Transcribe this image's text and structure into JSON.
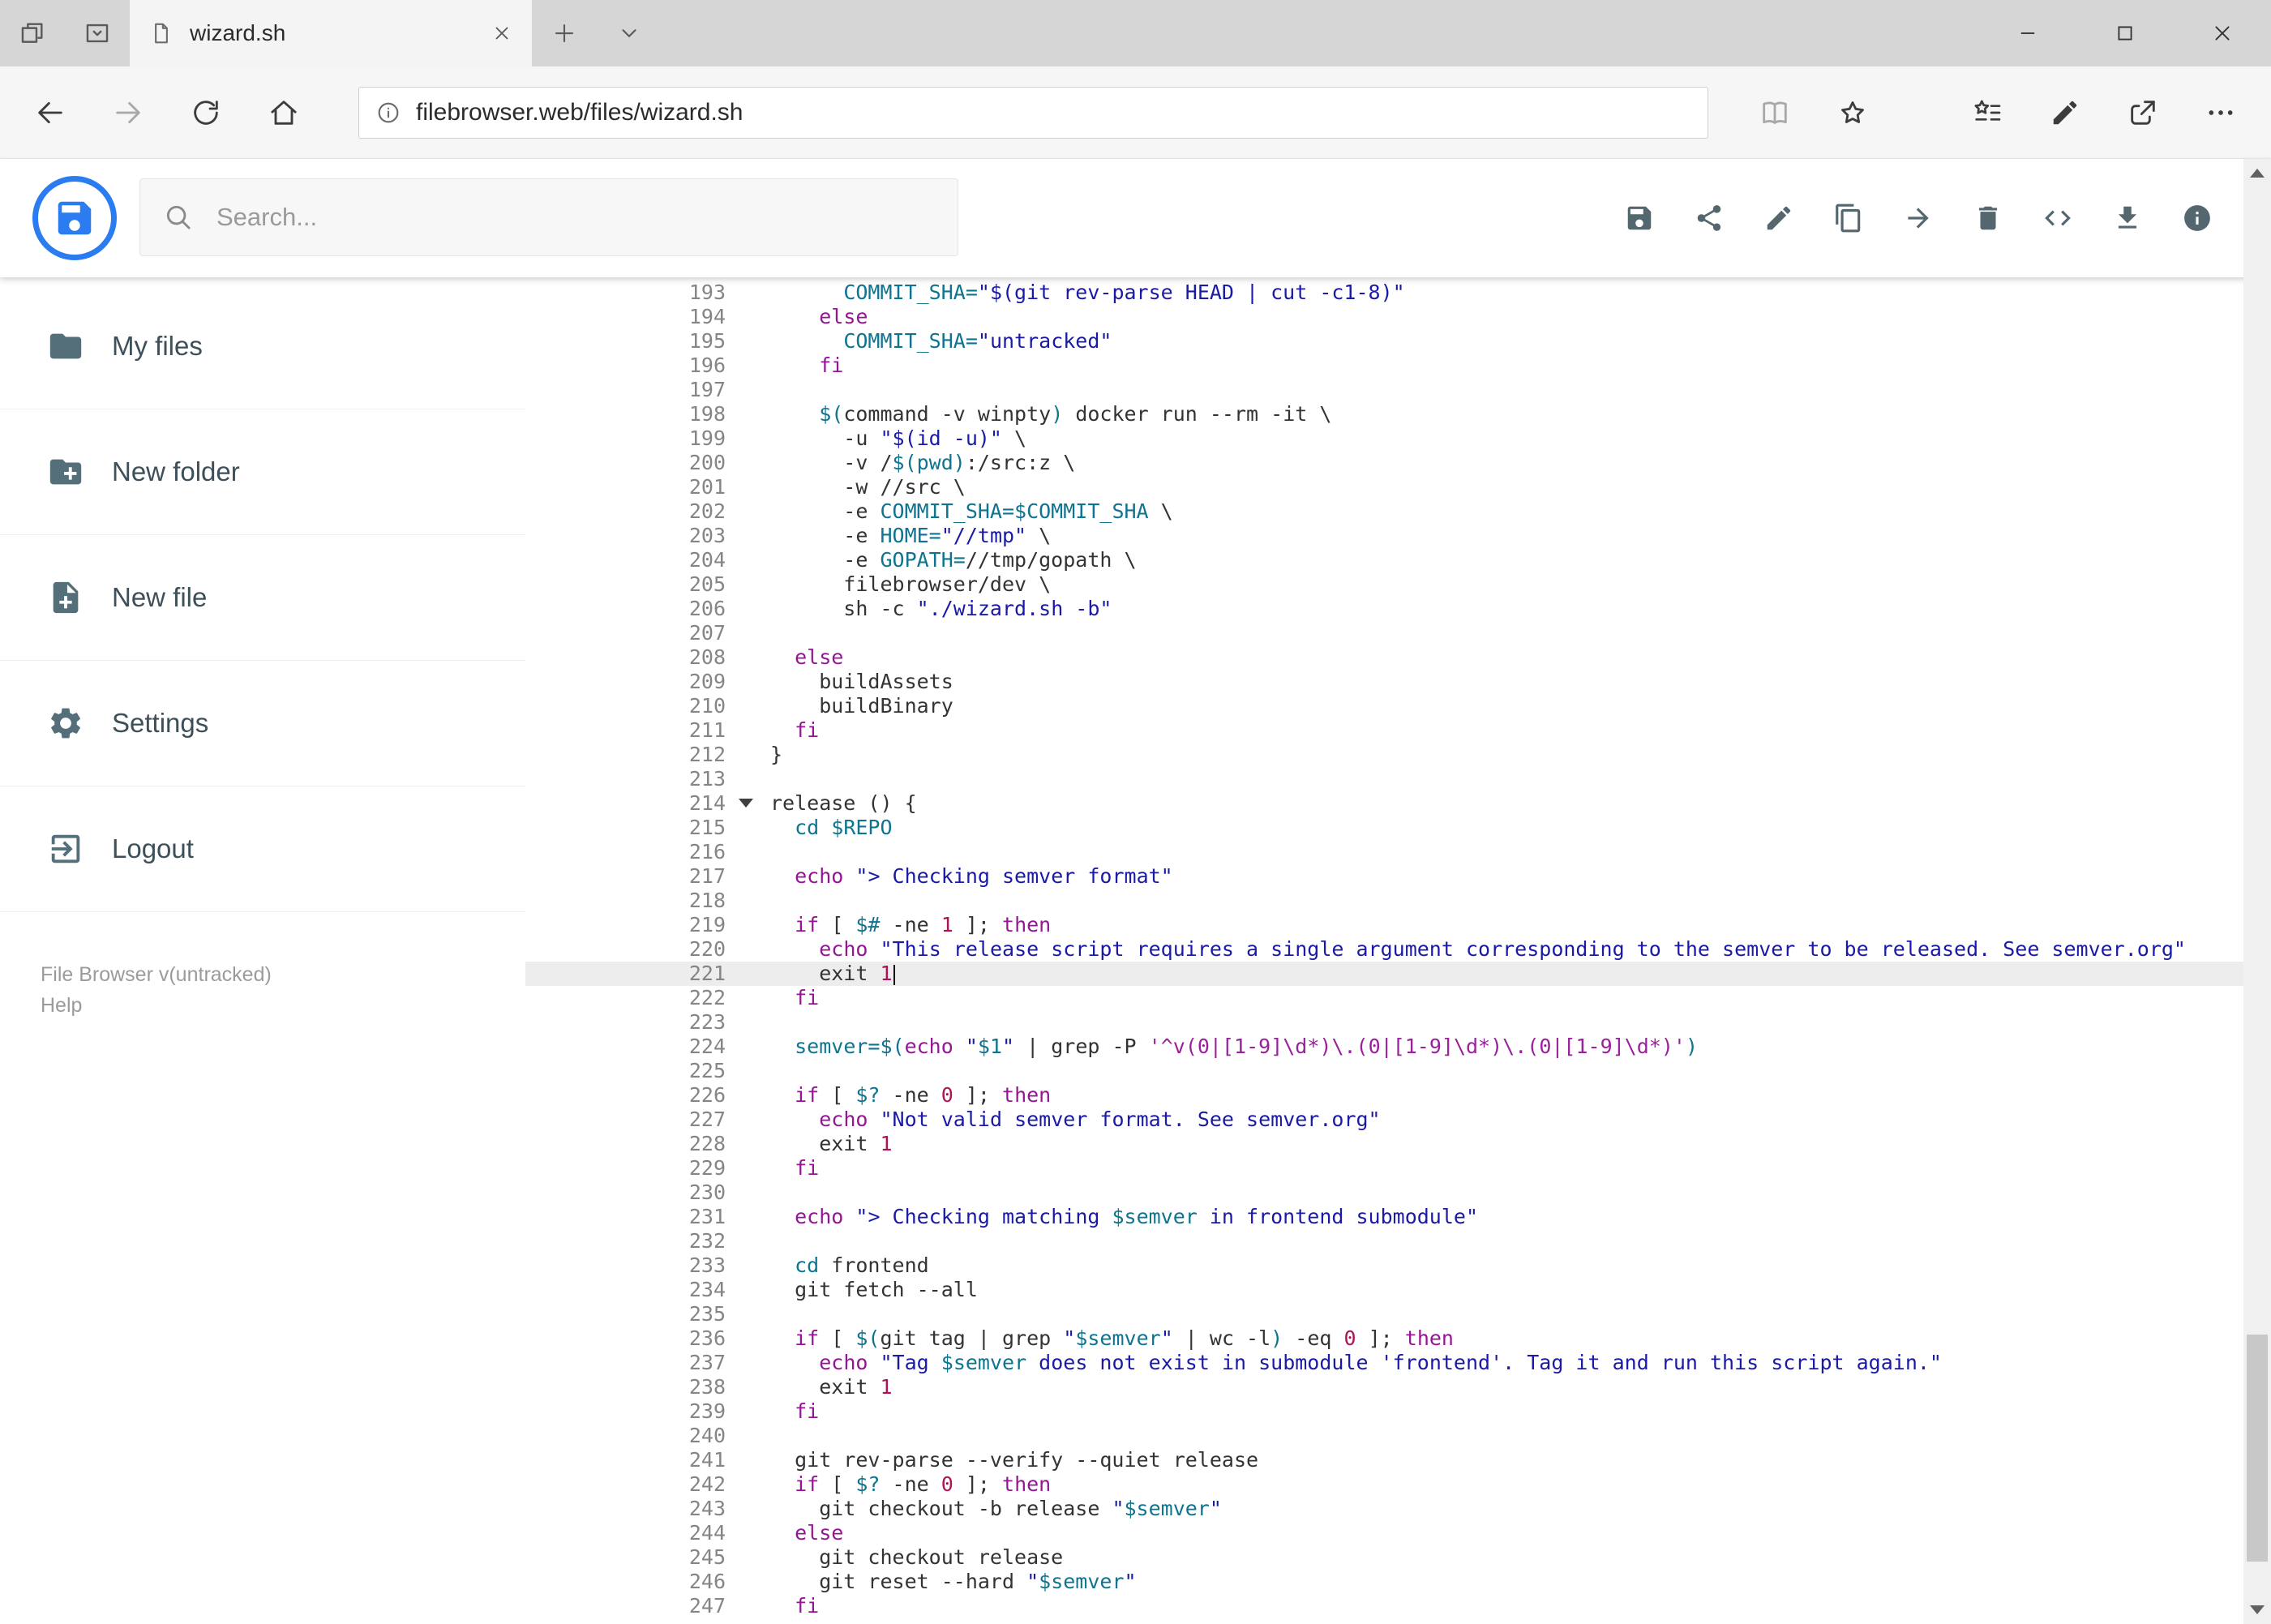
{
  "browser": {
    "tab": {
      "title": "wizard.sh"
    },
    "url": {
      "host": "filebrowser.web",
      "path": "/files/wizard.sh"
    }
  },
  "header": {
    "search_placeholder": "Search...",
    "toolbar": [
      {
        "name": "save",
        "icon": "save"
      },
      {
        "name": "share",
        "icon": "share"
      },
      {
        "name": "edit",
        "icon": "edit"
      },
      {
        "name": "copy",
        "icon": "copy"
      },
      {
        "name": "move",
        "icon": "arrow-forward"
      },
      {
        "name": "delete",
        "icon": "delete"
      },
      {
        "name": "raw-code",
        "icon": "code"
      },
      {
        "name": "download",
        "icon": "download"
      },
      {
        "name": "info",
        "icon": "info"
      }
    ]
  },
  "sidebar": {
    "items": [
      {
        "label": "My files",
        "icon": "folder"
      },
      {
        "label": "New folder",
        "icon": "create-new-folder"
      },
      {
        "label": "New file",
        "icon": "note-add"
      },
      {
        "label": "Settings",
        "icon": "settings"
      },
      {
        "label": "Logout",
        "icon": "logout"
      }
    ],
    "footer": {
      "version": "File Browser v(untracked)",
      "help": "Help"
    }
  },
  "colors": {
    "accent": "#2a7cf0",
    "icon_gray": "#54676f",
    "keyword": "#941694",
    "string": "#1a1aa6",
    "variable": "#0e7490"
  },
  "editor": {
    "active_line": 221,
    "lines": [
      {
        "n": 193,
        "t": [
          [
            "d",
            "      "
          ],
          [
            "v",
            "COMMIT_SHA="
          ],
          [
            "s",
            "\"$(git rev-parse HEAD | cut -c1-8)\""
          ]
        ]
      },
      {
        "n": 194,
        "t": [
          [
            "d",
            "    "
          ],
          [
            "k",
            "else"
          ]
        ]
      },
      {
        "n": 195,
        "t": [
          [
            "d",
            "      "
          ],
          [
            "v",
            "COMMIT_SHA="
          ],
          [
            "s",
            "\"untracked\""
          ]
        ]
      },
      {
        "n": 196,
        "t": [
          [
            "d",
            "    "
          ],
          [
            "k",
            "fi"
          ]
        ]
      },
      {
        "n": 197,
        "t": []
      },
      {
        "n": 198,
        "t": [
          [
            "d",
            "    "
          ],
          [
            "v",
            "$("
          ],
          [
            "d",
            "command -v winpty"
          ],
          [
            "v",
            ")"
          ],
          [
            "d",
            " docker run --rm -it \\"
          ]
        ]
      },
      {
        "n": 199,
        "t": [
          [
            "d",
            "      -u "
          ],
          [
            "s",
            "\"$(id -u)\""
          ],
          [
            "d",
            " \\"
          ]
        ]
      },
      {
        "n": 200,
        "t": [
          [
            "d",
            "      -v /"
          ],
          [
            "v",
            "$(pwd)"
          ],
          [
            "d",
            ":/src:z \\"
          ]
        ]
      },
      {
        "n": 201,
        "t": [
          [
            "d",
            "      -w //src \\"
          ]
        ]
      },
      {
        "n": 202,
        "t": [
          [
            "d",
            "      -e "
          ],
          [
            "v",
            "COMMIT_SHA=$COMMIT_SHA"
          ],
          [
            "d",
            " \\"
          ]
        ]
      },
      {
        "n": 203,
        "t": [
          [
            "d",
            "      -e "
          ],
          [
            "v",
            "HOME="
          ],
          [
            "s",
            "\"//tmp\""
          ],
          [
            "d",
            " \\"
          ]
        ]
      },
      {
        "n": 204,
        "t": [
          [
            "d",
            "      -e "
          ],
          [
            "v",
            "GOPATH="
          ],
          [
            "d",
            "//tmp/gopath \\"
          ]
        ]
      },
      {
        "n": 205,
        "t": [
          [
            "d",
            "      filebrowser/dev \\"
          ]
        ]
      },
      {
        "n": 206,
        "t": [
          [
            "d",
            "      sh -c "
          ],
          [
            "s",
            "\"./wizard.sh -b\""
          ]
        ]
      },
      {
        "n": 207,
        "t": []
      },
      {
        "n": 208,
        "t": [
          [
            "d",
            "  "
          ],
          [
            "k",
            "else"
          ]
        ]
      },
      {
        "n": 209,
        "t": [
          [
            "d",
            "    buildAssets"
          ]
        ]
      },
      {
        "n": 210,
        "t": [
          [
            "d",
            "    buildBinary"
          ]
        ]
      },
      {
        "n": 211,
        "t": [
          [
            "d",
            "  "
          ],
          [
            "k",
            "fi"
          ]
        ]
      },
      {
        "n": 212,
        "t": [
          [
            "d",
            "}"
          ]
        ]
      },
      {
        "n": 213,
        "t": []
      },
      {
        "n": 214,
        "fold": true,
        "t": [
          [
            "d",
            "release () {"
          ]
        ]
      },
      {
        "n": 215,
        "t": [
          [
            "d",
            "  "
          ],
          [
            "v",
            "cd"
          ],
          [
            "d",
            " "
          ],
          [
            "v",
            "$REPO"
          ]
        ]
      },
      {
        "n": 216,
        "t": []
      },
      {
        "n": 217,
        "t": [
          [
            "d",
            "  "
          ],
          [
            "k",
            "echo"
          ],
          [
            "d",
            " "
          ],
          [
            "s",
            "\"> Checking semver format\""
          ]
        ]
      },
      {
        "n": 218,
        "t": []
      },
      {
        "n": 219,
        "t": [
          [
            "d",
            "  "
          ],
          [
            "k",
            "if"
          ],
          [
            "d",
            " [ "
          ],
          [
            "v",
            "$#"
          ],
          [
            "d",
            " -ne "
          ],
          [
            "n",
            "1"
          ],
          [
            "d",
            " ]; "
          ],
          [
            "k",
            "then"
          ]
        ]
      },
      {
        "n": 220,
        "t": [
          [
            "d",
            "    "
          ],
          [
            "k",
            "echo"
          ],
          [
            "d",
            " "
          ],
          [
            "s",
            "\"This release script requires a single argument corresponding to the semver to be released. See semver.org\""
          ]
        ]
      },
      {
        "n": 221,
        "cursor": true,
        "t": [
          [
            "d",
            "    exit "
          ],
          [
            "n",
            "1"
          ]
        ]
      },
      {
        "n": 222,
        "t": [
          [
            "d",
            "  "
          ],
          [
            "k",
            "fi"
          ]
        ]
      },
      {
        "n": 223,
        "t": []
      },
      {
        "n": 224,
        "t": [
          [
            "d",
            "  "
          ],
          [
            "v",
            "semver=$("
          ],
          [
            "k",
            "echo"
          ],
          [
            "d",
            " "
          ],
          [
            "s",
            "\""
          ],
          [
            "v",
            "$1"
          ],
          [
            "s",
            "\""
          ],
          [
            "d",
            " | grep -P "
          ],
          [
            "r",
            "'^v(0|[1-9]\\d*)\\.(0|[1-9]\\d*)\\.(0|[1-9]\\d*)'"
          ],
          [
            "v",
            ")"
          ]
        ]
      },
      {
        "n": 225,
        "t": []
      },
      {
        "n": 226,
        "t": [
          [
            "d",
            "  "
          ],
          [
            "k",
            "if"
          ],
          [
            "d",
            " [ "
          ],
          [
            "v",
            "$?"
          ],
          [
            "d",
            " -ne "
          ],
          [
            "n",
            "0"
          ],
          [
            "d",
            " ]; "
          ],
          [
            "k",
            "then"
          ]
        ]
      },
      {
        "n": 227,
        "t": [
          [
            "d",
            "    "
          ],
          [
            "k",
            "echo"
          ],
          [
            "d",
            " "
          ],
          [
            "s",
            "\"Not valid semver format. See semver.org\""
          ]
        ]
      },
      {
        "n": 228,
        "t": [
          [
            "d",
            "    exit "
          ],
          [
            "n",
            "1"
          ]
        ]
      },
      {
        "n": 229,
        "t": [
          [
            "d",
            "  "
          ],
          [
            "k",
            "fi"
          ]
        ]
      },
      {
        "n": 230,
        "t": []
      },
      {
        "n": 231,
        "t": [
          [
            "d",
            "  "
          ],
          [
            "k",
            "echo"
          ],
          [
            "d",
            " "
          ],
          [
            "s",
            "\"> Checking matching "
          ],
          [
            "v",
            "$semver"
          ],
          [
            "s",
            " in frontend submodule\""
          ]
        ]
      },
      {
        "n": 232,
        "t": []
      },
      {
        "n": 233,
        "t": [
          [
            "d",
            "  "
          ],
          [
            "v",
            "cd"
          ],
          [
            "d",
            " frontend"
          ]
        ]
      },
      {
        "n": 234,
        "t": [
          [
            "d",
            "  git fetch --all"
          ]
        ]
      },
      {
        "n": 235,
        "t": []
      },
      {
        "n": 236,
        "t": [
          [
            "d",
            "  "
          ],
          [
            "k",
            "if"
          ],
          [
            "d",
            " [ "
          ],
          [
            "v",
            "$("
          ],
          [
            "d",
            "git tag | grep "
          ],
          [
            "s",
            "\""
          ],
          [
            "v",
            "$semver"
          ],
          [
            "s",
            "\""
          ],
          [
            "d",
            " | wc -l"
          ],
          [
            "v",
            ")"
          ],
          [
            "d",
            " -eq "
          ],
          [
            "n",
            "0"
          ],
          [
            "d",
            " ]; "
          ],
          [
            "k",
            "then"
          ]
        ]
      },
      {
        "n": 237,
        "t": [
          [
            "d",
            "    "
          ],
          [
            "k",
            "echo"
          ],
          [
            "d",
            " "
          ],
          [
            "s",
            "\"Tag "
          ],
          [
            "v",
            "$semver"
          ],
          [
            "s",
            " does not exist in submodule 'frontend'. Tag it and run this script again.\""
          ]
        ]
      },
      {
        "n": 238,
        "t": [
          [
            "d",
            "    exit "
          ],
          [
            "n",
            "1"
          ]
        ]
      },
      {
        "n": 239,
        "t": [
          [
            "d",
            "  "
          ],
          [
            "k",
            "fi"
          ]
        ]
      },
      {
        "n": 240,
        "t": []
      },
      {
        "n": 241,
        "t": [
          [
            "d",
            "  git rev-parse --verify --quiet release"
          ]
        ]
      },
      {
        "n": 242,
        "t": [
          [
            "d",
            "  "
          ],
          [
            "k",
            "if"
          ],
          [
            "d",
            " [ "
          ],
          [
            "v",
            "$?"
          ],
          [
            "d",
            " -ne "
          ],
          [
            "n",
            "0"
          ],
          [
            "d",
            " ]; "
          ],
          [
            "k",
            "then"
          ]
        ]
      },
      {
        "n": 243,
        "t": [
          [
            "d",
            "    git checkout -b release "
          ],
          [
            "s",
            "\""
          ],
          [
            "v",
            "$semver"
          ],
          [
            "s",
            "\""
          ]
        ]
      },
      {
        "n": 244,
        "t": [
          [
            "d",
            "  "
          ],
          [
            "k",
            "else"
          ]
        ]
      },
      {
        "n": 245,
        "t": [
          [
            "d",
            "    git checkout release"
          ]
        ]
      },
      {
        "n": 246,
        "t": [
          [
            "d",
            "    git reset --hard "
          ],
          [
            "s",
            "\""
          ],
          [
            "v",
            "$semver"
          ],
          [
            "s",
            "\""
          ]
        ]
      },
      {
        "n": 247,
        "t": [
          [
            "d",
            "  "
          ],
          [
            "k",
            "fi"
          ]
        ]
      }
    ]
  }
}
